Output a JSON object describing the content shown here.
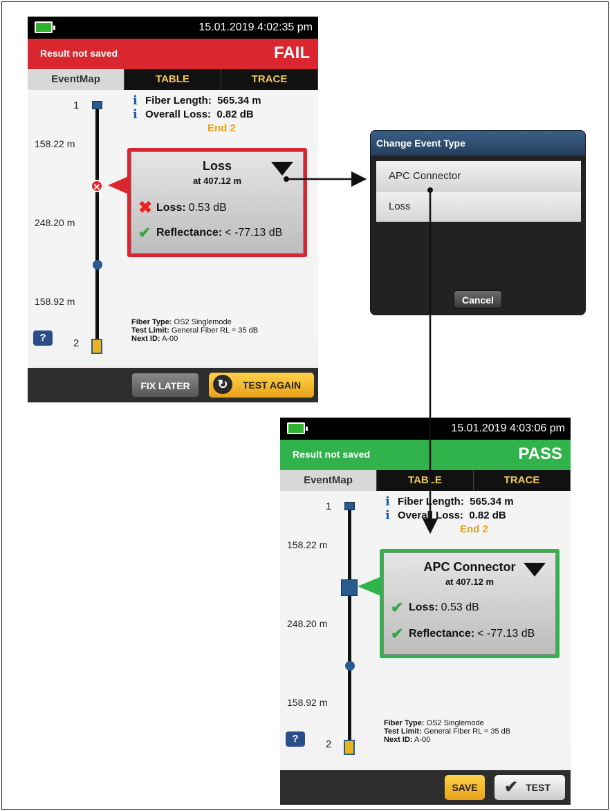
{
  "screen_fail": {
    "datetime": "15.01.2019 4:02:35 pm",
    "result_saved": "Result not saved",
    "result_status": "FAIL",
    "tabs": [
      "EventMap",
      "TABLE",
      "TRACE"
    ],
    "fiber_length_label": "Fiber Length:",
    "fiber_length_value": "565.34 m",
    "overall_loss_label": "Overall Loss:",
    "overall_loss_value": "0.82 dB",
    "end_label": "End 2",
    "end_top": "1",
    "end_bottom": "2",
    "distances": [
      "158.22 m",
      "248.20 m",
      "158.92 m"
    ],
    "event_title": "Loss",
    "event_location": "at 407.12 m",
    "loss_label": "Loss:",
    "loss_value": "0.53 dB",
    "reflectance_label": "Reflectance:",
    "reflectance_value": "< -77.13 dB",
    "fiber_type_label": "Fiber Type:",
    "fiber_type_value": "OS2 Singlemode",
    "test_limit_label": "Test Limit:",
    "test_limit_value": "General Fiber RL = 35 dB",
    "next_id_label": "Next ID:",
    "next_id_value": "A-00",
    "help": "?",
    "btn_fix_later": "FIX LATER",
    "btn_test_again": "TEST AGAIN"
  },
  "dialog": {
    "title": "Change Event Type",
    "options": [
      "APC Connector",
      "Loss"
    ],
    "cancel": "Cancel"
  },
  "screen_pass": {
    "datetime": "15.01.2019 4:03:06 pm",
    "result_saved": "Result not saved",
    "result_status": "PASS",
    "tabs": [
      "EventMap",
      "TABLE",
      "TRACE"
    ],
    "fiber_length_label": "Fiber Length:",
    "fiber_length_value": "565.34 m",
    "overall_loss_label": "Overall Loss:",
    "overall_loss_value": "0.82 dB",
    "end_label": "End 2",
    "end_top": "1",
    "end_bottom": "2",
    "distances": [
      "158.22 m",
      "248.20 m",
      "158.92 m"
    ],
    "event_title": "APC Connector",
    "event_location": "at 407.12 m",
    "loss_label": "Loss:",
    "loss_value": "0.53 dB",
    "reflectance_label": "Reflectance:",
    "reflectance_value": "< -77.13 dB",
    "fiber_type_label": "Fiber Type:",
    "fiber_type_value": "OS2 Singlemode",
    "test_limit_label": "Test Limit:",
    "test_limit_value": "General Fiber RL = 35 dB",
    "next_id_label": "Next ID:",
    "next_id_value": "A-00",
    "help": "?",
    "btn_save": "SAVE",
    "btn_test": "TEST"
  },
  "colors": {
    "fail": "#d9262f",
    "pass": "#2fb34a",
    "tab_text": "#f0c75a",
    "end_label": "#e8a21a",
    "node": "#2a5b8f"
  }
}
